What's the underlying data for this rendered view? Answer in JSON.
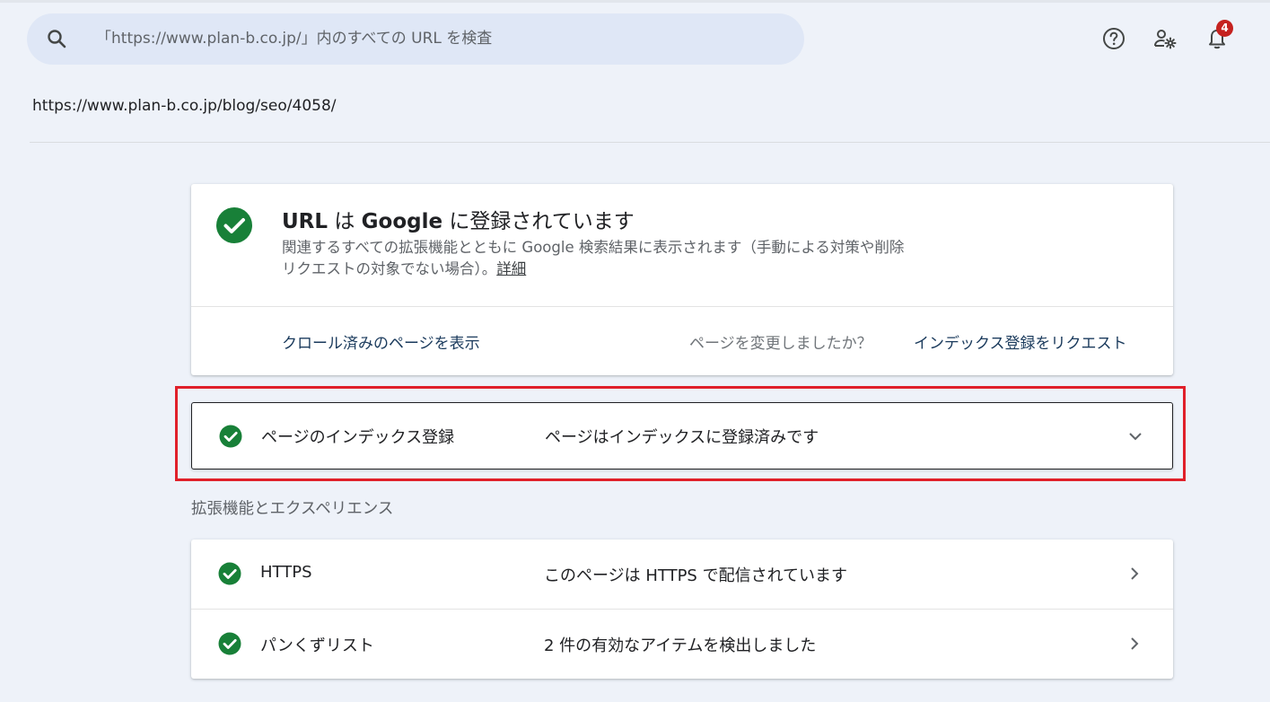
{
  "search": {
    "placeholder": "「https://www.plan-b.co.jp/」内のすべての URL を検査"
  },
  "toolbar": {
    "help_icon": "help-icon",
    "account_icon": "manage-users-icon",
    "notifications_icon": "bell-icon",
    "notification_count": "4"
  },
  "inspected_url": "https://www.plan-b.co.jp/blog/seo/4058/",
  "summary": {
    "title_url": "URL",
    "title_ha": " は ",
    "title_google": "Google",
    "title_rest": " に登録されています",
    "description": "関連するすべての拡張機能とともに Google 検索結果に表示されます（手動による対策や削除リクエストの対象でない場合）。",
    "details_link": "詳細",
    "view_crawled": "クロール済みのページを表示",
    "changed_question": "ページを変更しましたか？",
    "request_indexing": "インデックス登録をリクエスト"
  },
  "page_indexing": {
    "label": "ページのインデックス登録",
    "status": "ページはインデックスに登録済みです"
  },
  "enhancements": {
    "heading": "拡張機能とエクスペリエンス",
    "items": [
      {
        "label": "HTTPS",
        "status": "このページは HTTPS で配信されています"
      },
      {
        "label": "パンくずリスト",
        "status": "2 件の有効なアイテムを検出しました"
      }
    ]
  },
  "colors": {
    "success_green": "#188038",
    "highlight_red": "#e0202a",
    "badge_red": "#c5221f",
    "background": "#eef2f9"
  }
}
